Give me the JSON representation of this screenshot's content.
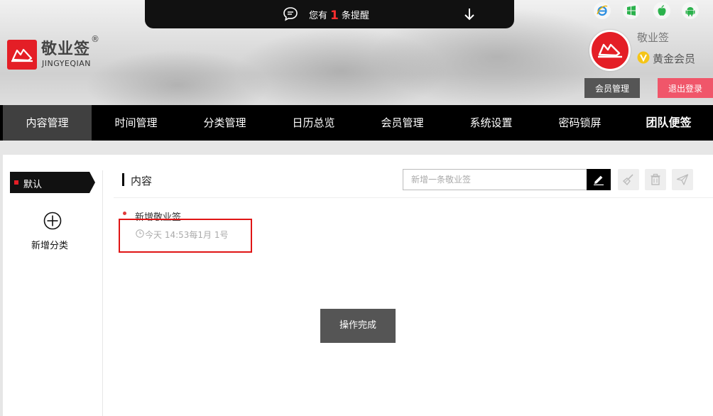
{
  "header": {
    "notification": {
      "prefix": "您有",
      "count": "1",
      "suffix": "条提醒"
    },
    "logo": {
      "name": "敬业签",
      "registered": "®",
      "sub": "JINGYEQIAN"
    },
    "platforms": [
      "ie-icon",
      "windows-icon",
      "apple-icon",
      "android-icon"
    ],
    "user": {
      "name": "敬业签",
      "level": "黄金会员"
    },
    "buttons": {
      "member": "会员管理",
      "logout": "退出登录"
    }
  },
  "nav": {
    "items": [
      "内容管理",
      "时间管理",
      "分类管理",
      "日历总览",
      "会员管理",
      "系统设置",
      "密码锁屏",
      "团队便签"
    ]
  },
  "sidebar": {
    "default_category": "默认",
    "add_category": "新增分类"
  },
  "content": {
    "section_title": "内容",
    "new_placeholder": "新增一条敬业签",
    "items": [
      {
        "title": "新增敬业签",
        "time": "今天 14:53每1月 1号"
      }
    ]
  },
  "toast": "操作完成",
  "colors": {
    "brand_red": "#e41e26",
    "nav_bg": "#000000",
    "nav_active": "#404040",
    "logout_pink": "#f0566a",
    "highlight_red": "#e01515"
  }
}
